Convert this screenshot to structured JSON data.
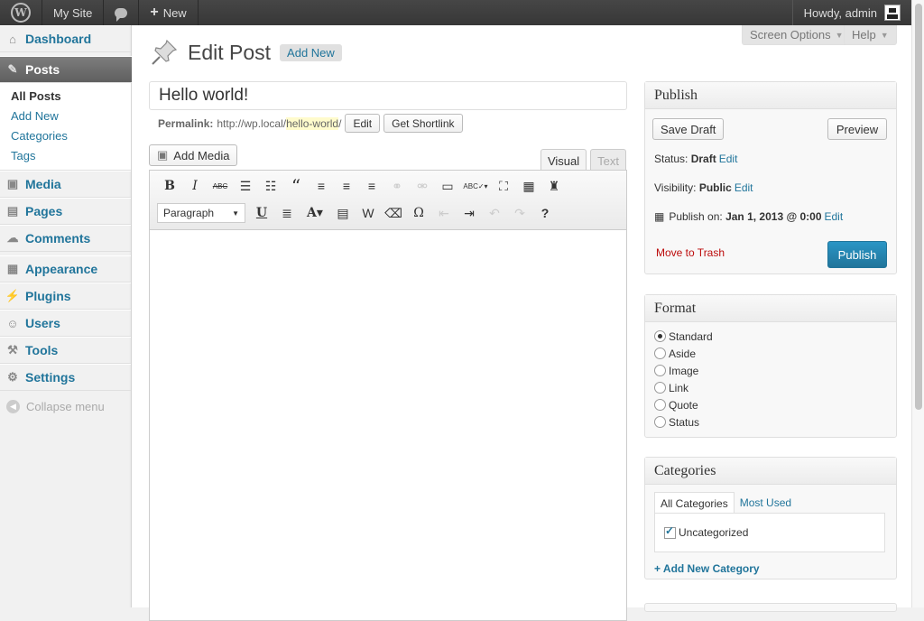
{
  "adminbar": {
    "site_name": "My Site",
    "new_label": "New",
    "howdy": "Howdy, admin"
  },
  "sidebar": {
    "items": [
      {
        "label": "Dashboard",
        "icon": "dashboard-icon"
      },
      {
        "label": "Posts",
        "icon": "pin-icon"
      },
      {
        "label": "Media",
        "icon": "media-icon"
      },
      {
        "label": "Pages",
        "icon": "pages-icon"
      },
      {
        "label": "Comments",
        "icon": "comments-icon"
      },
      {
        "label": "Appearance",
        "icon": "appearance-icon"
      },
      {
        "label": "Plugins",
        "icon": "plugins-icon"
      },
      {
        "label": "Users",
        "icon": "users-icon"
      },
      {
        "label": "Tools",
        "icon": "tools-icon"
      },
      {
        "label": "Settings",
        "icon": "settings-icon"
      }
    ],
    "submenu": [
      "All Posts",
      "Add New",
      "Categories",
      "Tags"
    ],
    "collapse": "Collapse menu"
  },
  "screen_options": "Screen Options",
  "help": "Help",
  "header": {
    "title": "Edit Post",
    "add_new": "Add New"
  },
  "post": {
    "title": "Hello world!",
    "permalink_label": "Permalink:",
    "permalink_base": "http://wp.local/",
    "permalink_slug": "hello-world",
    "permalink_end": "/",
    "edit_btn": "Edit",
    "shortlink_btn": "Get Shortlink"
  },
  "editor": {
    "add_media": "Add Media",
    "tab_visual": "Visual",
    "tab_text": "Text",
    "format_select": "Paragraph"
  },
  "publish": {
    "title": "Publish",
    "save_draft": "Save Draft",
    "preview": "Preview",
    "status_label": "Status:",
    "status_value": "Draft",
    "visibility_label": "Visibility:",
    "visibility_value": "Public",
    "publish_on_label": "Publish on:",
    "publish_on_value": "Jan 1, 2013 @ 0:00",
    "edit": "Edit",
    "trash": "Move to Trash",
    "publish_btn": "Publish"
  },
  "format": {
    "title": "Format",
    "options": [
      "Standard",
      "Aside",
      "Image",
      "Link",
      "Quote",
      "Status"
    ],
    "selected": "Standard"
  },
  "categories": {
    "title": "Categories",
    "tab_all": "All Categories",
    "tab_used": "Most Used",
    "items": [
      "Uncategorized"
    ],
    "add_new": "+ Add New Category"
  },
  "colors": {
    "link": "#21759b",
    "adminbar": "#464646",
    "primary_button": "#21759b",
    "trash": "#bc0b0b"
  }
}
